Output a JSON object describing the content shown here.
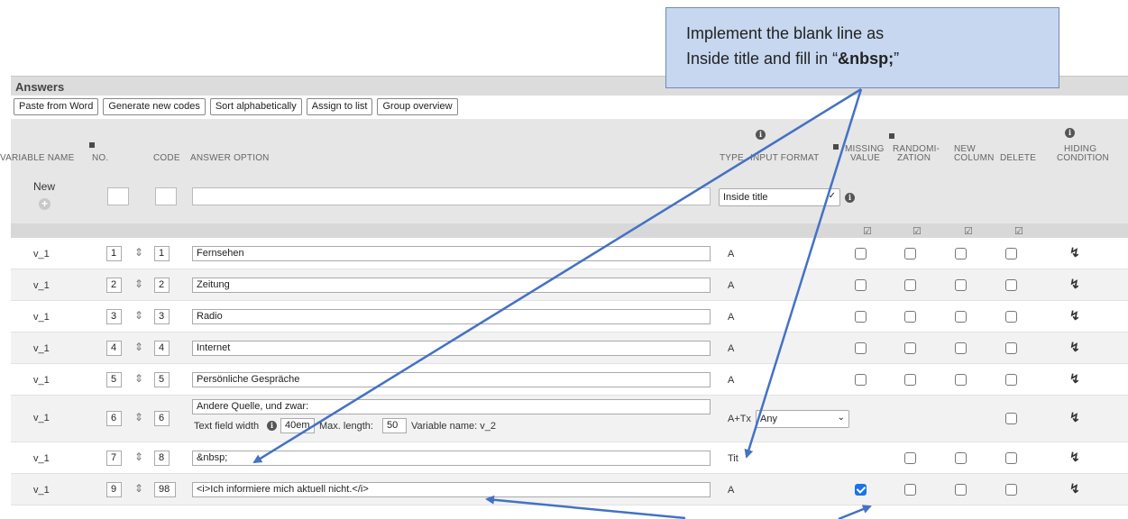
{
  "section_title": "Answers",
  "toolbar": [
    "Paste from Word",
    "Generate new codes",
    "Sort alphabetically",
    "Assign to list",
    "Group overview"
  ],
  "headers": {
    "variable_name": "VARIABLE NAME",
    "no": "NO.",
    "code": "CODE",
    "answer_option": "ANSWER OPTION",
    "type": "TYPE",
    "input_format": "INPUT FORMAT",
    "missing_value_1": "MISSING",
    "missing_value_2": "VALUE",
    "randomization_1": "RANDOMI-",
    "randomization_2": "ZATION",
    "new_column_1": "NEW",
    "new_column_2": "COLUMN",
    "delete": "DELETE",
    "hiding_condition_1": "HIDING",
    "hiding_condition_2": "CONDITION"
  },
  "new_row": {
    "label": "New",
    "type_select": "Inside title"
  },
  "rows": [
    {
      "var": "v_1",
      "no": "1",
      "code": "1",
      "answer": "Fernsehen",
      "type": "A",
      "missing": false
    },
    {
      "var": "v_1",
      "no": "2",
      "code": "2",
      "answer": "Zeitung",
      "type": "A",
      "missing": false
    },
    {
      "var": "v_1",
      "no": "3",
      "code": "3",
      "answer": "Radio",
      "type": "A",
      "missing": false
    },
    {
      "var": "v_1",
      "no": "4",
      "code": "4",
      "answer": "Internet",
      "type": "A",
      "missing": false
    },
    {
      "var": "v_1",
      "no": "5",
      "code": "5",
      "answer": "Persönliche Gespräche",
      "type": "A",
      "missing": false
    },
    {
      "var": "v_1",
      "no": "6",
      "code": "6",
      "answer": "Andere Quelle, und zwar:",
      "type": "A+Tx",
      "format": "Any",
      "text_field_width_label": "Text field width",
      "text_field_width": "40em",
      "max_length_label": "Max. length:",
      "max_length": "50",
      "variable_name_label": "Variable name: v_2"
    },
    {
      "var": "v_1",
      "no": "7",
      "code": "8",
      "answer": "&nbsp;",
      "type": "Tit"
    },
    {
      "var": "v_1",
      "no": "9",
      "code": "98",
      "answer": "<i>Ich informiere mich aktuell nicht.</i>",
      "type": "A",
      "missing": true
    }
  ],
  "callout": {
    "line1": "Implement the blank line as",
    "line2_prefix": "Inside title and fill in “",
    "line2_bold": "&nbsp;",
    "line2_suffix": "”"
  },
  "colors": {
    "callout_bg": "#c6d7ef",
    "arrow": "#4472c4",
    "checked": "#1a73e8",
    "header_bg": "#e6e6e6"
  },
  "icons": {
    "move": "move-updown-icon",
    "info": "info-icon",
    "hiding": "hiding-condition-icon",
    "plus": "plus-circle-icon"
  }
}
